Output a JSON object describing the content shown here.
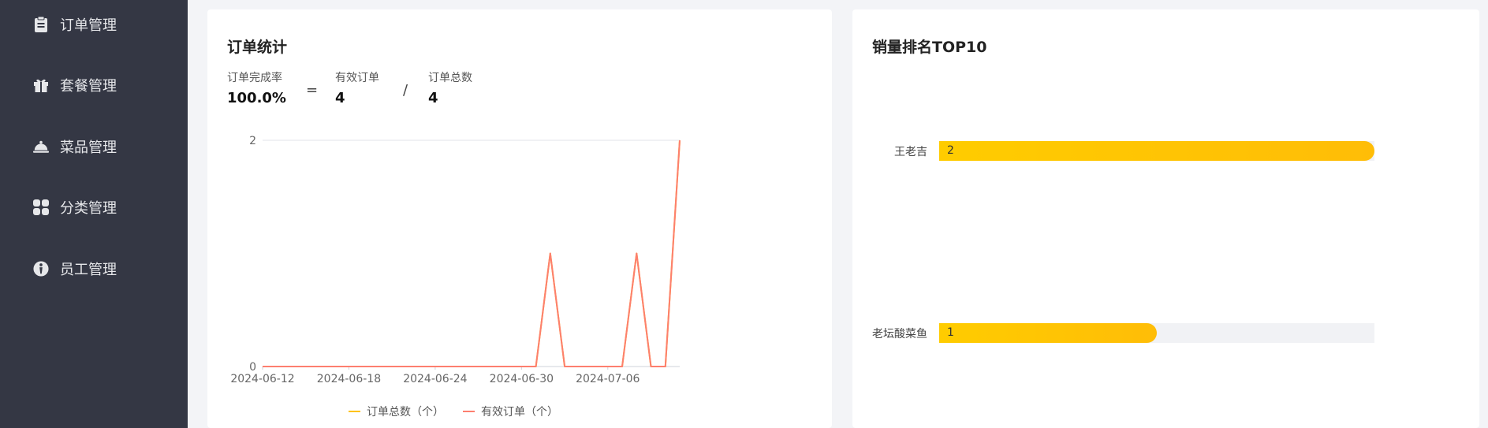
{
  "sidebar": {
    "items": [
      {
        "label": "订单管理",
        "icon": "clipboard-icon"
      },
      {
        "label": "套餐管理",
        "icon": "gift-icon"
      },
      {
        "label": "菜品管理",
        "icon": "cloche-icon"
      },
      {
        "label": "分类管理",
        "icon": "category-grid-icon"
      },
      {
        "label": "员工管理",
        "icon": "employee-icon"
      }
    ]
  },
  "order_stats": {
    "title": "订单统计",
    "completion_label": "订单完成率",
    "completion_value": "100.0%",
    "equals": "=",
    "valid_label": "有效订单",
    "valid_value": "4",
    "divide": "/",
    "total_label": "订单总数",
    "total_value": "4",
    "legend_total": "订单总数（个）",
    "legend_valid": "有效订单（个）",
    "legend_total_color": "#ffc200",
    "legend_valid_color": "#fd7f6f"
  },
  "ranking": {
    "title": "销量排名TOP10",
    "bar_color": "#ffc200"
  },
  "chart_data": [
    {
      "type": "line",
      "title": "",
      "x": [
        "2024-06-12",
        "2024-06-13",
        "2024-06-14",
        "2024-06-15",
        "2024-06-16",
        "2024-06-17",
        "2024-06-18",
        "2024-06-19",
        "2024-06-20",
        "2024-06-21",
        "2024-06-22",
        "2024-06-23",
        "2024-06-24",
        "2024-06-25",
        "2024-06-26",
        "2024-06-27",
        "2024-06-28",
        "2024-06-29",
        "2024-06-30",
        "2024-07-01",
        "2024-07-02",
        "2024-07-03",
        "2024-07-04",
        "2024-07-05",
        "2024-07-06",
        "2024-07-07",
        "2024-07-08",
        "2024-07-09",
        "2024-07-10",
        "2024-07-11"
      ],
      "xticks": [
        "2024-06-12",
        "2024-06-18",
        "2024-06-24",
        "2024-06-30",
        "2024-07-06"
      ],
      "yticks": [
        "0",
        "2"
      ],
      "ylim": [
        0,
        2
      ],
      "grid": true,
      "legend_position": "bottom",
      "series": [
        {
          "name": "订单总数（个）",
          "color": "#ffc200",
          "values": [
            0,
            0,
            0,
            0,
            0,
            0,
            0,
            0,
            0,
            0,
            0,
            0,
            0,
            0,
            0,
            0,
            0,
            0,
            0,
            0,
            1,
            0,
            0,
            0,
            0,
            0,
            1,
            0,
            0,
            2
          ]
        },
        {
          "name": "有效订单（个）",
          "color": "#fd7f6f",
          "values": [
            0,
            0,
            0,
            0,
            0,
            0,
            0,
            0,
            0,
            0,
            0,
            0,
            0,
            0,
            0,
            0,
            0,
            0,
            0,
            0,
            1,
            0,
            0,
            0,
            0,
            0,
            1,
            0,
            0,
            2
          ]
        }
      ]
    },
    {
      "type": "bar",
      "orientation": "horizontal",
      "title": "销量排名TOP10",
      "categories": [
        "王老吉",
        "老坛酸菜鱼"
      ],
      "values": [
        2,
        1
      ],
      "xlim": [
        0,
        2
      ]
    }
  ]
}
